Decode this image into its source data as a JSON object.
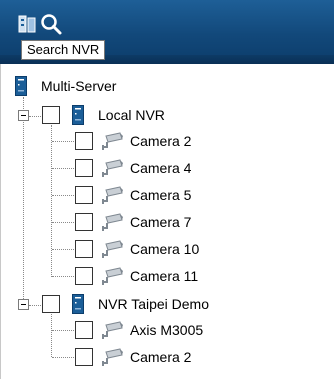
{
  "toolbar": {
    "tooltip": "Search NVR",
    "icons": [
      "servers-icon",
      "search-icon"
    ]
  },
  "tree": {
    "root": {
      "label": "Multi-Server"
    },
    "groups": [
      {
        "label": "Local NVR",
        "checked": false,
        "expanded": true,
        "cameras": [
          "Camera 2",
          "Camera 4",
          "Camera 5",
          "Camera 7",
          "Camera 10",
          "Camera 11"
        ]
      },
      {
        "label": "NVR Taipei Demo",
        "checked": false,
        "expanded": true,
        "cameras": [
          "Axis M3005",
          "Camera 2"
        ]
      }
    ]
  },
  "colors": {
    "toolbar": "#12487a",
    "server_icon": "#1b5e98",
    "camera_icon": "#7f8891"
  }
}
